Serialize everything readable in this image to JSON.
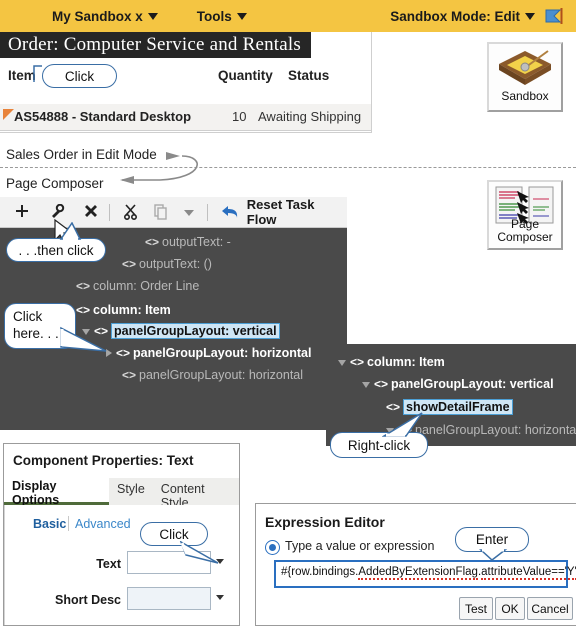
{
  "topbar": {
    "sandbox_name": "My Sandbox x",
    "tools": "Tools",
    "mode": "Sandbox Mode: Edit",
    "flag_icon": "flag-icon",
    "bg_color": "#f4c542"
  },
  "order_panel": {
    "title": "Order: Computer Service and Rentals",
    "columns": [
      "Item",
      "Quantity",
      "Status"
    ],
    "rows": [
      {
        "item": "AS54888 - Standard Desktop",
        "quantity": "10",
        "status": "Awaiting Shipping"
      }
    ]
  },
  "desktop_icons": [
    {
      "name": "sandbox-icon",
      "caption": "Sandbox"
    },
    {
      "name": "page-composer-icon",
      "caption_line1": "Page",
      "caption_line2": "Composer"
    }
  ],
  "annotations": {
    "sales_order": "Sales Order in Edit Mode",
    "page_composer": "Page Composer"
  },
  "composer": {
    "toolbar": {
      "add": "+",
      "edit": "edit-icon",
      "delete": "×",
      "cut": "scissors-icon",
      "copy": "copy-icon",
      "more": "chevron-down-icon",
      "reset_label": "Reset Task Flow",
      "reset_icon": "undo-arrow-icon"
    },
    "tree": [
      {
        "label": "outputText: -",
        "state": "dim",
        "indent": 145,
        "twisty": "none",
        "selected": false
      },
      {
        "label": "outputText: ()",
        "state": "dim",
        "indent": 122,
        "twisty": "none",
        "selected": false
      },
      {
        "label": "column: Order Line",
        "state": "dim",
        "indent": 76,
        "twisty": "none",
        "selected": false
      },
      {
        "label": "column: Item",
        "state": "bright",
        "indent": 76,
        "twisty": "none",
        "selected": false
      },
      {
        "label": "panelGroupLayout: vertical",
        "state": "bright",
        "indent": 82,
        "twisty": "open",
        "selected": true
      },
      {
        "label": "panelGroupLayout: horizontal",
        "state": "bright",
        "indent": 106,
        "twisty": "closed",
        "selected": false
      },
      {
        "label": "panelGroupLayout: horizontal",
        "state": "dim",
        "indent": 122,
        "twisty": "none",
        "selected": false
      }
    ],
    "tree2": [
      {
        "label": "column: Item",
        "state": "bright",
        "indent": 12,
        "twisty": "open",
        "selected": false
      },
      {
        "label": "panelGroupLayout: vertical",
        "state": "bright",
        "indent": 36,
        "twisty": "open",
        "selected": false
      },
      {
        "label": "showDetailFrame",
        "state": "bright",
        "indent": 60,
        "twisty": "none",
        "selected": true
      },
      {
        "label": "panelGroupLayout: horizontal",
        "state": "dim",
        "indent": 60,
        "twisty": "open",
        "selected": false
      }
    ]
  },
  "component_properties": {
    "title": "Component Properties: Text",
    "tabs": [
      {
        "label": "Display Options",
        "active": true
      },
      {
        "label": "Style",
        "active": false
      },
      {
        "label": "Content Style",
        "active": false
      }
    ],
    "subtabs": [
      {
        "label": "Basic",
        "active": true
      },
      {
        "label": "Advanced",
        "active": false
      }
    ],
    "fields": [
      {
        "label": "Text",
        "value": "",
        "shaded": false
      },
      {
        "label": "Short Desc",
        "value": "",
        "shaded": true
      }
    ]
  },
  "expression_editor": {
    "title": "Expression Editor",
    "radio_label": "Type a value or expression",
    "expression_prefix": "#{row.bindings.",
    "expression_part1": "AddedByExtensionFlag",
    "expression_mid": ".",
    "expression_part2": "attributeValue=='Y'",
    "expression_suffix": "}",
    "expression_full": "#{row.bindings.AddedByExtensionFlag.attributeValue=='Y'}",
    "buttons": [
      "Test",
      "OK",
      "Cancel"
    ]
  },
  "callouts": [
    {
      "name": "callout-click-item",
      "text": "Click"
    },
    {
      "name": "callout-then-click",
      "text": ". . .then click"
    },
    {
      "name": "callout-click-here",
      "line1": "Click",
      "line2": "here. . ."
    },
    {
      "name": "callout-right-click",
      "text": "Right-click"
    },
    {
      "name": "callout-click-text-field",
      "text": "Click"
    },
    {
      "name": "callout-enter",
      "text": "Enter"
    }
  ],
  "colors": {
    "accent_yellow": "#f4c542",
    "tree_bg": "#4a4a4a",
    "selection_blue": "#cfe6f5",
    "callout_border": "#3a6ea5",
    "row_marker_orange": "#e8833a"
  }
}
